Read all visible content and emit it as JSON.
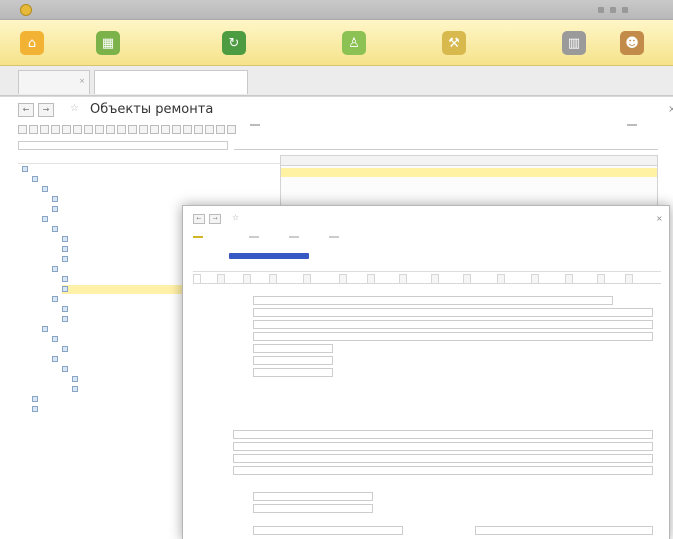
{
  "app": {
    "title": "",
    "toolbar_sections": [
      {
        "label": ""
      },
      {
        "label": ""
      },
      {
        "label": ""
      },
      {
        "label": ""
      },
      {
        "label": ""
      },
      {
        "label": ""
      },
      {
        "label": ""
      }
    ]
  },
  "tabs": [
    {
      "label": ""
    },
    {
      "label": ""
    }
  ],
  "main": {
    "title": "Объекты ремонта",
    "toolbar_action": "",
    "toolbar_more": "",
    "filter_placeholder": "",
    "filter_right": "",
    "left_tree": [
      {
        "label": ""
      },
      {
        "label": ""
      },
      {
        "label": ""
      },
      {
        "label": ""
      },
      {
        "label": ""
      },
      {
        "label": ""
      },
      {
        "label": ""
      },
      {
        "label": ""
      },
      {
        "label": ""
      },
      {
        "label": ""
      },
      {
        "label": ""
      },
      {
        "label": ""
      },
      {
        "label": ""
      },
      {
        "label": ""
      },
      {
        "label": ""
      },
      {
        "label": ""
      },
      {
        "label": ""
      },
      {
        "label": ""
      },
      {
        "label": ""
      },
      {
        "label": ""
      },
      {
        "label": ""
      },
      {
        "label": ""
      },
      {
        "label": ""
      },
      {
        "label": ""
      },
      {
        "label": ""
      }
    ],
    "grid": {
      "headers": [
        "",
        "",
        "",
        ""
      ],
      "rows": [
        {
          "name": "",
          "c2": "",
          "c3": "",
          "c4": ""
        },
        {
          "name": "",
          "c2": "",
          "c3": "",
          "c4": ""
        },
        {
          "name": "",
          "c2": "",
          "c3": "",
          "c4": ""
        }
      ]
    }
  },
  "dialog": {
    "title": "",
    "buttons": [
      "",
      "",
      "",
      ""
    ],
    "more": "",
    "header_left": "",
    "header_right": "",
    "tabs": [
      "",
      "",
      "",
      "",
      "",
      "",
      "",
      "",
      "",
      "",
      "",
      "",
      "",
      "",
      "",
      ""
    ],
    "groups": [
      {
        "title": "",
        "fields": [
          {
            "label": "",
            "value": ""
          },
          {
            "label": "",
            "value": ""
          },
          {
            "label": "",
            "value": ""
          },
          {
            "label": "",
            "value": ""
          },
          {
            "label": "",
            "value": ""
          },
          {
            "label": "",
            "value": ""
          },
          {
            "label": "",
            "value": ""
          },
          {
            "label": "",
            "value": ""
          }
        ]
      },
      {
        "title": "",
        "fields": [
          {
            "label": "",
            "value": ""
          },
          {
            "label": "",
            "value": ""
          }
        ]
      },
      {
        "title": "",
        "fields": [
          {
            "label": "",
            "value": ""
          },
          {
            "label": "",
            "value": ""
          },
          {
            "label": "",
            "value": ""
          },
          {
            "label": "",
            "value": ""
          }
        ]
      },
      {
        "title": "",
        "fields": [
          {
            "label": "",
            "value": ""
          },
          {
            "label": "",
            "value": ""
          }
        ]
      },
      {
        "title": "",
        "fields": [
          {
            "label": "",
            "value": ""
          },
          {
            "label": "",
            "value": ""
          }
        ]
      }
    ]
  },
  "colors": {
    "toolbar_yellow": "#f5e38a",
    "selected_yellow": "#fff1a8",
    "primary_button": "#f5d647",
    "progress_blue": "#3759c4",
    "link_blue": "#3a69c8"
  }
}
